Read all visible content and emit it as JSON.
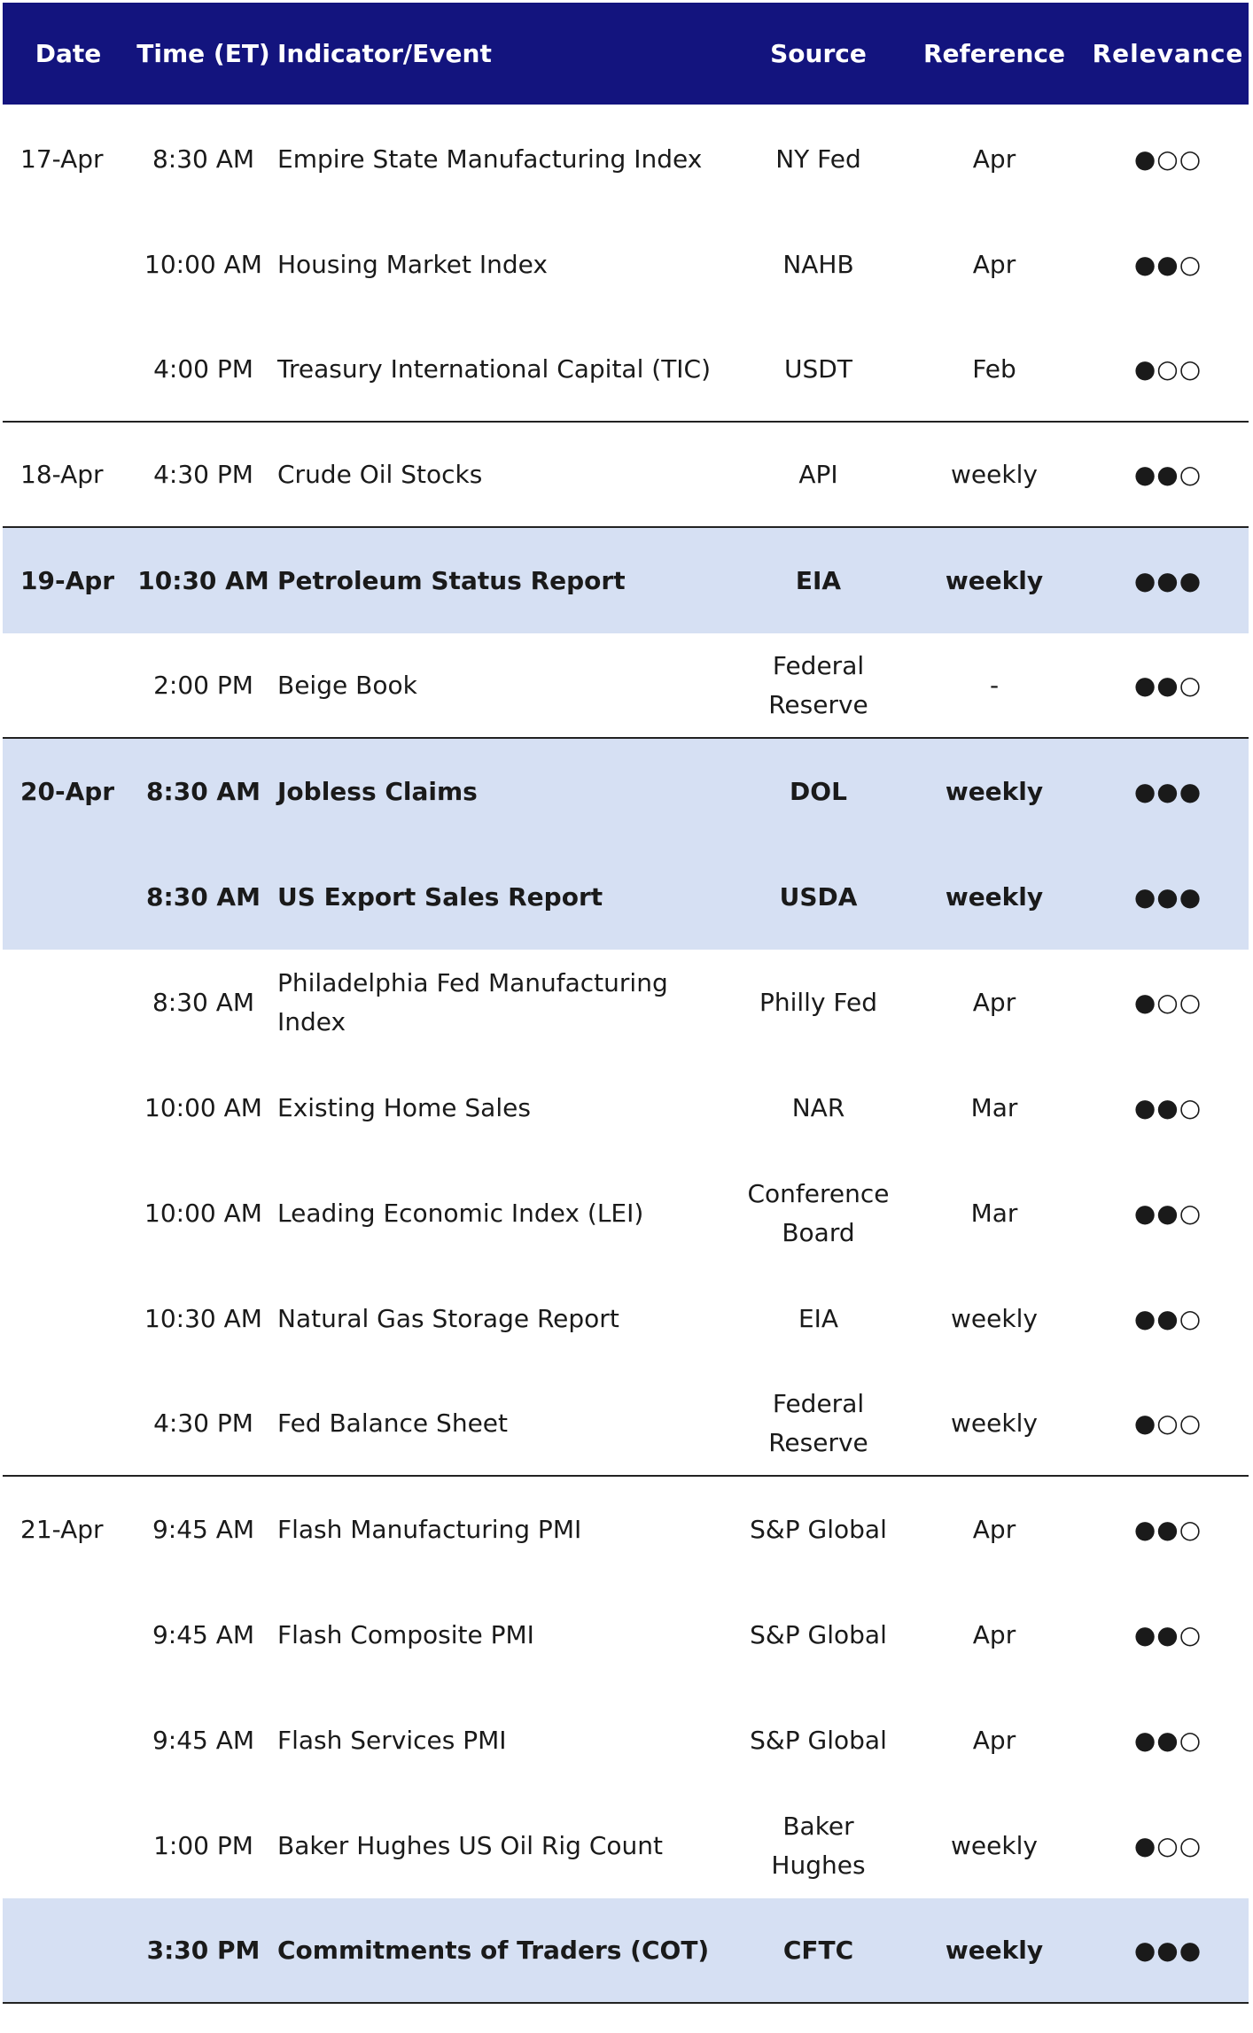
{
  "header": {
    "date": "Date",
    "time": "Time (ET)",
    "indicator": "Indicator/Event",
    "source": "Source",
    "reference": "Reference",
    "relevance": "Relevance"
  },
  "rows": [
    {
      "date": "17-Apr",
      "time": "8:30 AM",
      "indicator": "Empire State Manufacturing Index",
      "source": "NY Fed",
      "reference": "Apr",
      "relevance": "●○○",
      "highlight": false,
      "bold": false,
      "separator": false
    },
    {
      "date": "",
      "time": "10:00 AM",
      "indicator": "Housing Market Index",
      "source": "NAHB",
      "reference": "Apr",
      "relevance": "●●○",
      "highlight": false,
      "bold": false,
      "separator": false
    },
    {
      "date": "",
      "time": "4:00 PM",
      "indicator": "Treasury International Capital (TIC)",
      "source": "USDT",
      "reference": "Feb",
      "relevance": "●○○",
      "highlight": false,
      "bold": false,
      "separator": true
    },
    {
      "date": "18-Apr",
      "time": "4:30 PM",
      "indicator": "Crude Oil Stocks",
      "source": "API",
      "reference": "weekly",
      "relevance": "●●○",
      "highlight": false,
      "bold": false,
      "separator": true
    },
    {
      "date": "19-Apr",
      "time": "10:30 AM",
      "indicator": "Petroleum Status Report",
      "source": "EIA",
      "reference": "weekly",
      "relevance": "●●●",
      "highlight": true,
      "bold": true,
      "separator": false
    },
    {
      "date": "",
      "time": "2:00 PM",
      "indicator": "Beige Book",
      "source": "Federal Reserve",
      "reference": "-",
      "relevance": "●●○",
      "highlight": false,
      "bold": false,
      "separator": true
    },
    {
      "date": "20-Apr",
      "time": "8:30 AM",
      "indicator": "Jobless Claims",
      "source": "DOL",
      "reference": "weekly",
      "relevance": "●●●",
      "highlight": true,
      "bold": true,
      "separator": false
    },
    {
      "date": "",
      "time": "8:30 AM",
      "indicator": "US Export Sales Report",
      "source": "USDA",
      "reference": "weekly",
      "relevance": "●●●",
      "highlight": true,
      "bold": true,
      "separator": false
    },
    {
      "date": "",
      "time": "8:30 AM",
      "indicator": "Philadelphia Fed Manufacturing Index",
      "source": "Philly Fed",
      "reference": "Apr",
      "relevance": "●○○",
      "highlight": false,
      "bold": false,
      "separator": false
    },
    {
      "date": "",
      "time": "10:00 AM",
      "indicator": "Existing Home Sales",
      "source": "NAR",
      "reference": "Mar",
      "relevance": "●●○",
      "highlight": false,
      "bold": false,
      "separator": false
    },
    {
      "date": "",
      "time": "10:00 AM",
      "indicator": "Leading Economic Index (LEI)",
      "source": "Conference Board",
      "reference": "Mar",
      "relevance": "●●○",
      "highlight": false,
      "bold": false,
      "separator": false
    },
    {
      "date": "",
      "time": "10:30 AM",
      "indicator": "Natural Gas Storage Report",
      "source": "EIA",
      "reference": "weekly",
      "relevance": "●●○",
      "highlight": false,
      "bold": false,
      "separator": false
    },
    {
      "date": "",
      "time": "4:30 PM",
      "indicator": "Fed Balance Sheet",
      "source": "Federal Reserve",
      "reference": "weekly",
      "relevance": "●○○",
      "highlight": false,
      "bold": false,
      "separator": true
    },
    {
      "date": "21-Apr",
      "time": "9:45 AM",
      "indicator": "Flash Manufacturing PMI",
      "source": "S&P Global",
      "reference": "Apr",
      "relevance": "●●○",
      "highlight": false,
      "bold": false,
      "separator": false
    },
    {
      "date": "",
      "time": "9:45 AM",
      "indicator": "Flash Composite PMI",
      "source": "S&P Global",
      "reference": "Apr",
      "relevance": "●●○",
      "highlight": false,
      "bold": false,
      "separator": false
    },
    {
      "date": "",
      "time": "9:45 AM",
      "indicator": "Flash Services PMI",
      "source": "S&P Global",
      "reference": "Apr",
      "relevance": "●●○",
      "highlight": false,
      "bold": false,
      "separator": false
    },
    {
      "date": "",
      "time": "1:00 PM",
      "indicator": "Baker Hughes US Oil Rig Count",
      "source": "Baker Hughes",
      "reference": "weekly",
      "relevance": "●○○",
      "highlight": false,
      "bold": false,
      "separator": false
    },
    {
      "date": "",
      "time": "3:30 PM",
      "indicator": "Commitments of Traders (COT)",
      "source": "CFTC",
      "reference": "weekly",
      "relevance": "●●●",
      "highlight": true,
      "bold": true,
      "separator": true
    }
  ]
}
